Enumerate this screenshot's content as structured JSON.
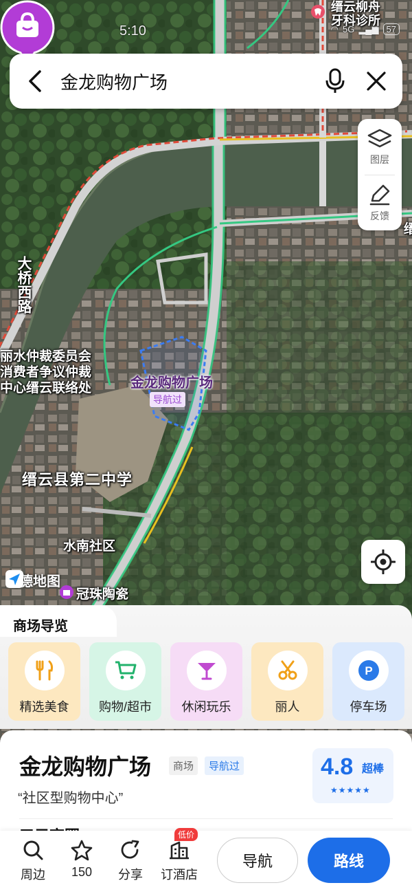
{
  "status_bar": {
    "time": "5:10",
    "network": "5G",
    "battery": "57"
  },
  "search": {
    "query": "金龙购物广场"
  },
  "tools": {
    "layers_label": "图层",
    "feedback_label": "反馈"
  },
  "map": {
    "labels": {
      "clinic": "缙云柳舟\n牙科诊所",
      "road": "大桥西路",
      "arbitration_1": "丽水仲裁委员会",
      "arbitration_2": "消费者争议仲裁",
      "arbitration_3": "中心缙云联络处",
      "school": "缙云县第二中学",
      "community": "水南社区",
      "shop": "冠珠陶瓷",
      "edge_char": "缙"
    },
    "poi": {
      "name": "金龙购物广场",
      "tag": "导航过"
    },
    "logo": "高德地图"
  },
  "mall_guide": {
    "title": "商场导览",
    "categories": [
      {
        "label": "精选美食",
        "icon": "food-icon",
        "bg": "#fde8c0"
      },
      {
        "label": "购物/超市",
        "icon": "shopping-cart-icon",
        "bg": "#d6f5e6"
      },
      {
        "label": "休闲玩乐",
        "icon": "cocktail-icon",
        "bg": "#f6dcf6"
      },
      {
        "label": "丽人",
        "icon": "scissors-icon",
        "bg": "#fde8c0"
      },
      {
        "label": "停车场",
        "icon": "parking-icon",
        "bg": "#dbe9fd"
      }
    ]
  },
  "place": {
    "name": "金龙购物广场",
    "type_badge": "商场",
    "visited_badge": "导航过",
    "quote": "“社区型购物中心”",
    "rating": "4.8",
    "rating_level": "超棒",
    "stars": "★★★★★",
    "peek_title": "五元商圈"
  },
  "bottom_bar": {
    "nearby": "周边",
    "favorites_count": "150",
    "share": "分享",
    "hotel": "订酒店",
    "hotel_badge": "低价",
    "navigate": "导航",
    "route": "路线"
  },
  "colors": {
    "accent": "#1d6ee8",
    "poi_purple": "#b23cd6",
    "road_green": "#35c882"
  }
}
